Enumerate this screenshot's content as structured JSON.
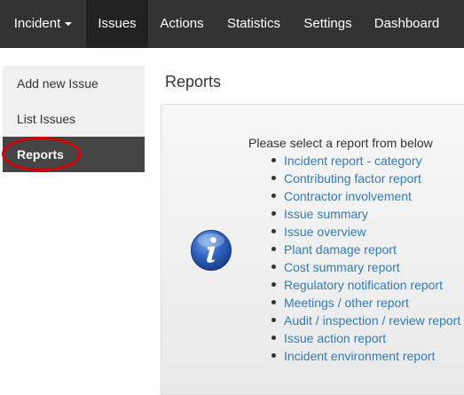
{
  "navbar": {
    "incident_label": "Incident",
    "items": [
      {
        "label": "Issues",
        "active": true
      },
      {
        "label": "Actions",
        "active": false
      },
      {
        "label": "Statistics",
        "active": false
      },
      {
        "label": "Settings",
        "active": false
      },
      {
        "label": "Dashboard",
        "active": false
      }
    ]
  },
  "sidebar": {
    "items": [
      {
        "label": "Add new Issue",
        "active": false
      },
      {
        "label": "List Issues",
        "active": false
      },
      {
        "label": "Reports",
        "active": true
      }
    ]
  },
  "main": {
    "title": "Reports",
    "intro": "Please select a report from below",
    "info_icon": "info-icon",
    "reports": [
      "Incident report - category",
      "Contributing factor report",
      "Contractor involvement",
      "Issue summary",
      "Issue overview",
      "Plant damage report",
      "Cost summary report",
      "Regulatory notification report",
      "Meetings / other report",
      "Audit / inspection / review report",
      "Issue action report",
      "Incident environment report"
    ]
  },
  "colors": {
    "navbar_bg": "#333333",
    "navbar_active": "#222222",
    "sidebar_active": "#454545",
    "link": "#337ab7",
    "highlight": "#d40000"
  }
}
